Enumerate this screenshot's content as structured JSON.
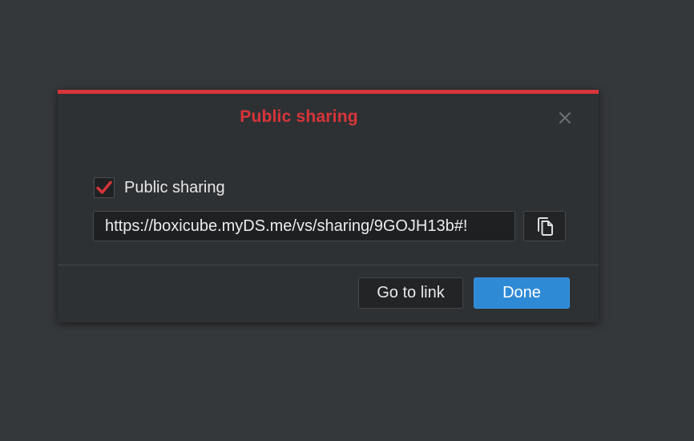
{
  "dialog": {
    "title": "Public sharing",
    "accent_color": "#d8353a",
    "close_icon": "close-icon",
    "public_sharing": {
      "checked": true,
      "label": "Public sharing"
    },
    "share_link": {
      "value": "https://boxicube.myDS.me/vs/sharing/9GOJH13b#!",
      "copy_icon": "copy-icon"
    },
    "buttons": {
      "go_to_link": "Go to link",
      "done": "Done"
    },
    "primary_color": "#2f8ad6"
  }
}
